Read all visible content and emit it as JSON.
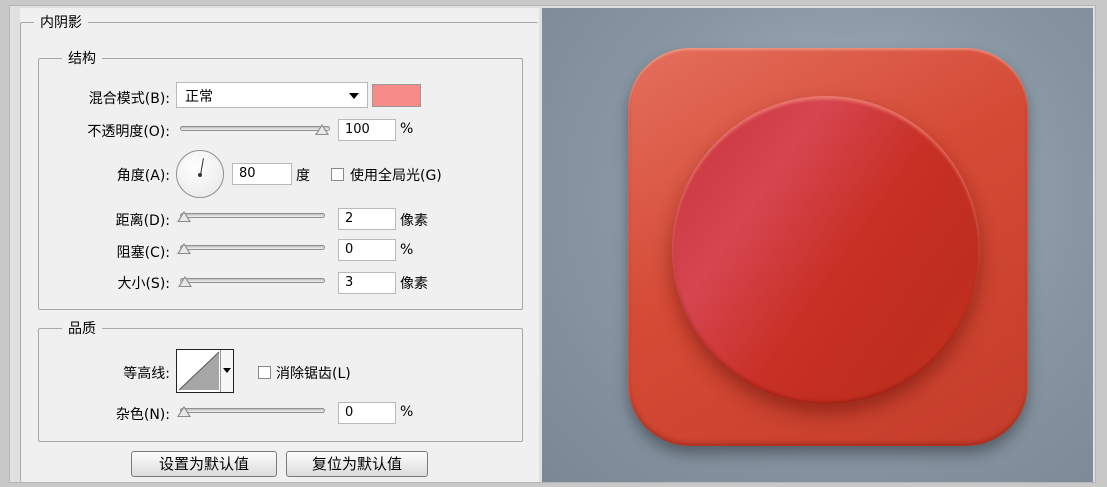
{
  "panel": {
    "title": "内阴影",
    "structure": {
      "title": "结构",
      "blend_mode_label": "混合模式(B):",
      "blend_mode_value": "正常",
      "blend_color": "#f58a88",
      "opacity_label": "不透明度(O):",
      "opacity_value": "100",
      "opacity_unit": "%",
      "angle_label": "角度(A):",
      "angle_value": "80",
      "angle_unit": "度",
      "global_light_label": "使用全局光(G)",
      "distance_label": "距离(D):",
      "distance_value": "2",
      "distance_unit": "像素",
      "choke_label": "阻塞(C):",
      "choke_value": "0",
      "choke_unit": "%",
      "size_label": "大小(S):",
      "size_value": "3",
      "size_unit": "像素"
    },
    "quality": {
      "title": "品质",
      "contour_label": "等高线:",
      "anti_alias_label": "消除锯齿(L)",
      "noise_label": "杂色(N):",
      "noise_value": "0",
      "noise_unit": "%"
    },
    "buttons": {
      "set_default": "设置为默认值",
      "reset_default": "复位为默认值"
    }
  }
}
